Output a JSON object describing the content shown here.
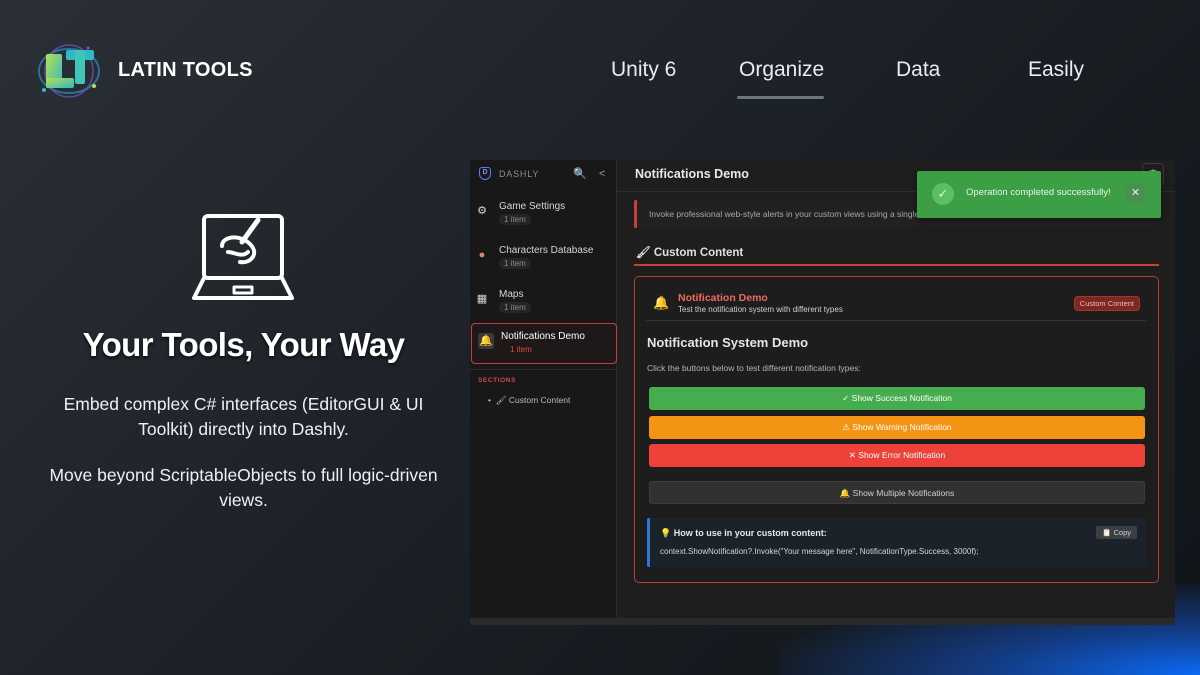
{
  "brand": {
    "name": "LATIN TOOLS"
  },
  "nav": {
    "items": [
      {
        "label": "Unity 6"
      },
      {
        "label": "Organize"
      },
      {
        "label": "Data"
      },
      {
        "label": "Easily"
      }
    ],
    "active": "Organize"
  },
  "hero": {
    "title": "Your Tools, Your Way",
    "paragraph1": "Embed complex C# interfaces (EditorGUI & UI Toolkit) directly into Dashly.",
    "paragraph2": "Move beyond ScriptableObjects to full logic-driven views."
  },
  "app": {
    "sidebar": {
      "title": "DASHLY",
      "badge": "D",
      "items": [
        {
          "label": "Game Settings",
          "count": "1 item",
          "icon": "gear-icon"
        },
        {
          "label": "Characters Database",
          "count": "1 item",
          "icon": "character-icon"
        },
        {
          "label": "Maps",
          "count": "1 item",
          "icon": "map-icon"
        },
        {
          "label": "Notifications Demo",
          "count": "1 item",
          "icon": "bell-icon"
        }
      ],
      "sections_label": "SECTIONS",
      "section_item": "Custom Content"
    },
    "main": {
      "title": "Notifications Demo",
      "info": "Invoke professional web-style alerts in your custom views using a single line of code.",
      "section_heading": "Custom Content",
      "panel": {
        "title": "Notification Demo",
        "subtitle": "Test the notification system with different types",
        "badge": "Custom Content",
        "heading": "Notification System Demo",
        "description": "Click the buttons below to test different notification types:",
        "buttons": {
          "success": "✓ Show Success Notification",
          "warning": "⚠ Show Warning Notification",
          "error": "✕ Show Error Notification",
          "multiple": "🔔 Show Multiple Notifications"
        },
        "howto": {
          "title": "💡 How to use in your custom content:",
          "copy": "📋 Copy",
          "code": "context.ShowNotification?.Invoke(\"Your message here\", NotificationType.Success, 3000f);"
        }
      }
    },
    "toast": {
      "message": "Operation completed successfully!"
    }
  },
  "colors": {
    "accent_red": "#c9403a",
    "success": "#45ad4e",
    "warning": "#f39415",
    "error": "#ee413a",
    "info_blue": "#2a7bd8"
  }
}
